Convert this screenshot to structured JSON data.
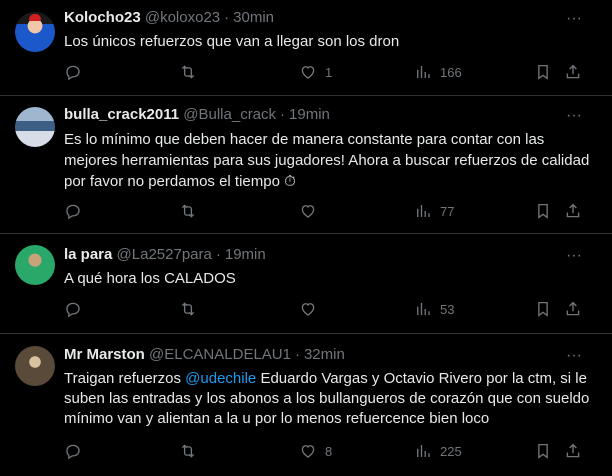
{
  "tweets": [
    {
      "name": "Kolocho23",
      "handle": "@koloxo23",
      "time": "30min",
      "text": "Los únicos refuerzos que van a llegar son los dron",
      "replies": "",
      "retweets": "",
      "likes": "1",
      "views": "166"
    },
    {
      "name": "bulla_crack2011",
      "handle": "@Bulla_crack",
      "time": "19min",
      "text": "Es lo mínimo que deben hacer de manera constante para contar con las mejores herramientas para sus jugadores! Ahora a buscar refuerzos de calidad por favor no perdamos el tiempo ⏱",
      "replies": "",
      "retweets": "",
      "likes": "",
      "views": "77"
    },
    {
      "name": "la para",
      "handle": "@La2527para",
      "time": "19min",
      "text": "A qué hora los CALADOS",
      "replies": "",
      "retweets": "",
      "likes": "",
      "views": "53"
    },
    {
      "name": "Mr Marston",
      "handle": "@ELCANALDELAU1",
      "time": "32min",
      "text_before": "Traigan refuerzos ",
      "mention": "@udechile",
      "text_after": " Eduardo Vargas y Octavio Rivero por la ctm, si le suben las entradas y los abonos a los bullangueros de corazón que con sueldo mínimo van y alientan a la u por lo menos refuercence bien loco",
      "replies": "",
      "retweets": "",
      "likes": "8",
      "views": "225"
    }
  ],
  "more_label": "···",
  "colors": {
    "background": "#000000",
    "text": "#e7e9ea",
    "muted": "#71767b",
    "link": "#1d9bf0",
    "divider": "#2f3336"
  },
  "icons": [
    "reply-icon",
    "retweet-icon",
    "like-icon",
    "views-icon",
    "bookmark-icon",
    "share-icon",
    "more-icon"
  ]
}
